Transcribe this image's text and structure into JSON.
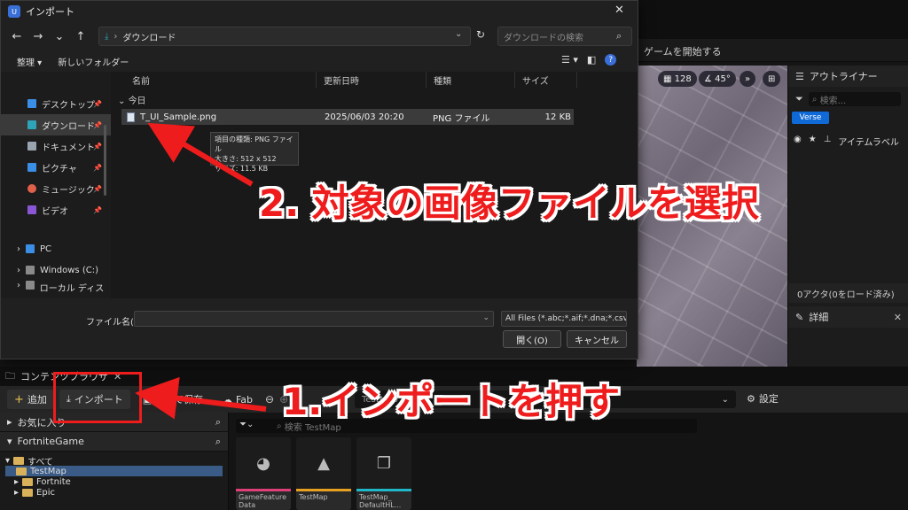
{
  "editor": {
    "start_game": "ゲームを開始する",
    "viewport_grid": "128",
    "viewport_angle": "45°",
    "outliner": {
      "title": "アウトライナー",
      "search_placeholder": "検索...",
      "verse_label": "Verse",
      "column_label": "アイテムラベル",
      "status": "0アクタ(0をロード済み)",
      "details_title": "詳細"
    }
  },
  "dialog": {
    "title": "インポート",
    "address": "ダウンロード",
    "search_placeholder": "ダウンロードの検索",
    "commands": {
      "organize": "整理 ▾",
      "new_folder": "新しいフォルダー"
    },
    "nav": [
      {
        "label": "デスクトップ",
        "icon": "desktop-icon",
        "color": "#3a8ee6"
      },
      {
        "label": "ダウンロード",
        "icon": "download-icon",
        "color": "#2fa3b8",
        "selected": true
      },
      {
        "label": "ドキュメント",
        "icon": "document-icon",
        "color": "#9aa4b0"
      },
      {
        "label": "ピクチャ",
        "icon": "picture-icon",
        "color": "#3a8ee6"
      },
      {
        "label": "ミュージック",
        "icon": "music-icon",
        "color": "#e0604a"
      },
      {
        "label": "ビデオ",
        "icon": "video-icon",
        "color": "#8a56d6"
      }
    ],
    "tree": {
      "pc": "PC",
      "drive_c": "Windows (C:)",
      "drive_local": "ローカル ディスク"
    },
    "columns": {
      "name": "名前",
      "date": "更新日時",
      "type": "種類",
      "size": "サイズ"
    },
    "group_label": "今日",
    "file": {
      "name": "T_UI_Sample.png",
      "date": "2025/06/03 20:20",
      "type": "PNG ファイル",
      "size": "12 KB"
    },
    "tooltip": {
      "line1": "項目の種類: PNG ファイル",
      "line2": "大きさ: 512 x 512",
      "line3": "サイズ: 11.5 KB"
    },
    "filename_label": "ファイル名(N):",
    "filetype": "All Files (*.abc;*.aif;*.dna;*.csv;*.e",
    "open_button": "開く(O)",
    "cancel_button": "キャンセル"
  },
  "content_browser": {
    "tab_title": "コンテンツブラウザ",
    "add_button": "追加",
    "import_button": "インポート",
    "save_button": "すべて保存",
    "fab_button": "Fab",
    "path_value": "TestMap",
    "settings": "設定",
    "favorites": "お気に入り",
    "project": "FortniteGame",
    "tree": [
      "すべて",
      "TestMap",
      "Fortnite",
      "Epic"
    ],
    "filter_placeholder": "検索 TestMap",
    "assets": [
      {
        "label": "GameFeature Data",
        "color": "#e0407a",
        "icon": "pie-icon"
      },
      {
        "label": "TestMap",
        "color": "#e8a020",
        "icon": "landscape-icon"
      },
      {
        "label": "TestMap_ DefaultHL...",
        "color": "#20b8c8",
        "icon": "layers-icon"
      }
    ]
  },
  "annotations": {
    "step1": "1.インポートを押す",
    "step2": "2. 対象の画像ファイルを選択"
  }
}
